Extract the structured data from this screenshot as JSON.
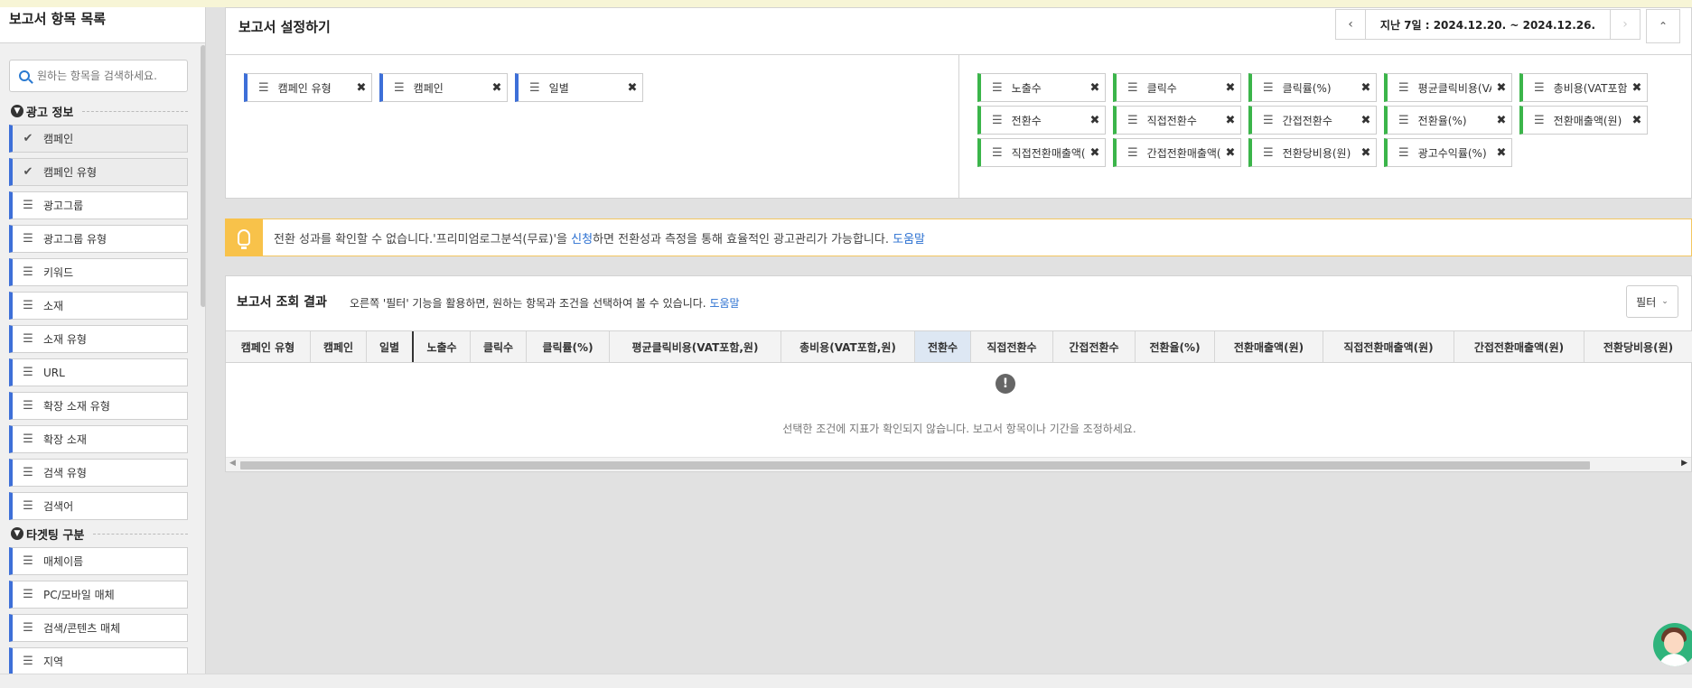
{
  "sidebar": {
    "title": "보고서 항목 목록",
    "search_placeholder": "원하는 항목을 검색하세요.",
    "groups": [
      {
        "name": "광고 정보",
        "items": [
          {
            "label": "캠페인",
            "checked": true
          },
          {
            "label": "캠페인 유형",
            "checked": true
          },
          {
            "label": "광고그룹",
            "checked": false
          },
          {
            "label": "광고그룹 유형",
            "checked": false
          },
          {
            "label": "키워드",
            "checked": false
          },
          {
            "label": "소재",
            "checked": false
          },
          {
            "label": "소재 유형",
            "checked": false
          },
          {
            "label": "URL",
            "checked": false
          },
          {
            "label": "확장 소재 유형",
            "checked": false
          },
          {
            "label": "확장 소재",
            "checked": false
          },
          {
            "label": "검색 유형",
            "checked": false
          },
          {
            "label": "검색어",
            "checked": false
          }
        ]
      },
      {
        "name": "타겟팅 구분",
        "items": [
          {
            "label": "매체이름",
            "checked": false
          },
          {
            "label": "PC/모바일 매체",
            "checked": false
          },
          {
            "label": "검색/콘텐츠 매체",
            "checked": false
          },
          {
            "label": "지역",
            "checked": false
          }
        ]
      }
    ]
  },
  "settings": {
    "title": "보고서 설정하기",
    "date_range": "지난 7일 : 2024.12.20. ~ 2024.12.26.",
    "dimensions": [
      "캠페인 유형",
      "캠페인",
      "일별"
    ],
    "metrics": [
      "노출수",
      "클릭수",
      "클릭률(%)",
      "평균클릭비용(VAT포함,원)",
      "총비용(VAT포함,원)",
      "전환수",
      "직접전환수",
      "간접전환수",
      "전환율(%)",
      "전환매출액(원)",
      "직접전환매출액(원)",
      "간접전환매출액(원)",
      "전환당비용(원)",
      "광고수익률(%)"
    ]
  },
  "notice": {
    "text_1": "전환 성과를 확인할 수 없습니다.'프리미엄로그분석(무료)'을 ",
    "link_1": "신청",
    "text_2": "하면 전환성과 측정을 통해 효율적인 광고관리가 가능합니다. ",
    "link_2": "도움말"
  },
  "results": {
    "title": "보고서 조회 결과",
    "desc": "오른쪽 '필터' 기능을 활용하면, 원하는 항목과 조건을 선택하여 볼 수 있습니다. ",
    "help_link": "도움말",
    "filter_label": "필터",
    "columns": [
      "캠페인 유형",
      "캠페인",
      "일별",
      "노출수",
      "클릭수",
      "클릭률(%)",
      "평균클릭비용(VAT포함,원)",
      "총비용(VAT포함,원)",
      "전환수",
      "직접전환수",
      "간접전환수",
      "전환율(%)",
      "전환매출액(원)",
      "직접전환매출액(원)",
      "간접전환매출액(원)",
      "전환당비용(원)"
    ],
    "selected_column": "전환수",
    "empty_message": "선택한 조건에 지표가 확인되지 않습니다. 보고서 항목이나 기간을 조정하세요."
  },
  "colors": {
    "dimension_accent": "#3d6fd8",
    "metric_accent": "#3bb54a",
    "notice_accent": "#f8c24a",
    "link": "#2a6fd1"
  }
}
